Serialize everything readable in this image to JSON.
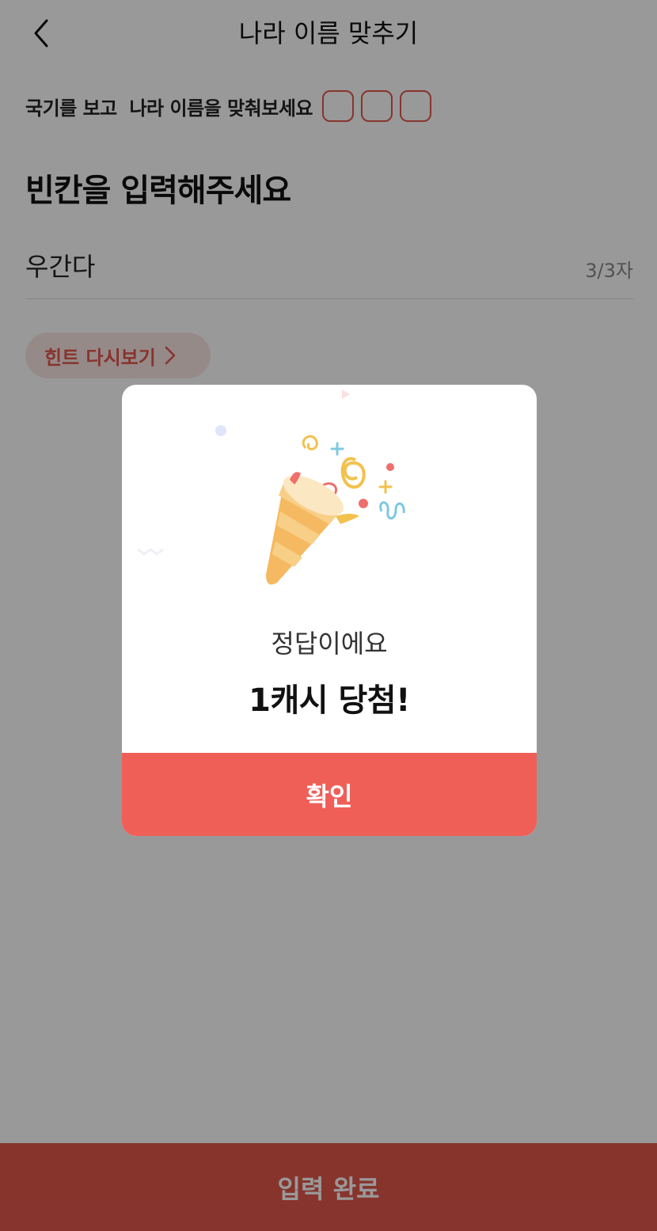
{
  "header": {
    "title": "나라 이름 맞추기",
    "back_icon": "chevron-left-icon"
  },
  "instruction": {
    "text": "국기를 보고  나라 이름을 맞춰보세요",
    "box_count": 3
  },
  "heading": "빈칸을 입력해주세요",
  "answer": {
    "value": "우간다",
    "char_count": "3/3자"
  },
  "hint_button": {
    "label": "힌트 다시보기",
    "icon": "chevron-right-icon"
  },
  "submit_button": {
    "label": "입력 완료"
  },
  "modal": {
    "illustration": "party-popper-icon",
    "subtitle": "정답이에요",
    "title": "1캐시 당첨!",
    "confirm_label": "확인"
  },
  "colors": {
    "accent": "#e2574c",
    "confirm": "#ef5f58",
    "overlay": "rgba(0,0,0,0.4)"
  }
}
